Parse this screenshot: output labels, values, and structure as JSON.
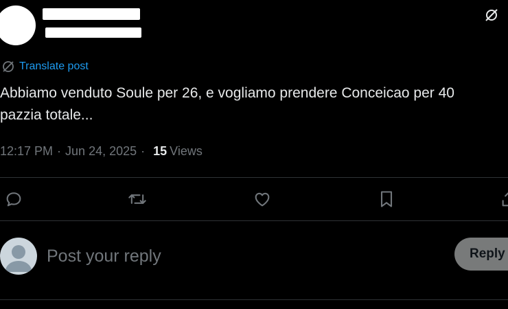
{
  "post": {
    "translate_label": "Translate post",
    "text": "Abbiamo venduto Soule per 26, e vogliamo prendere Conceicao per 40\npazzia totale...",
    "time": "12:17 PM",
    "date": "Jun 24, 2025",
    "views_count": "15",
    "views_label": "Views"
  },
  "reply": {
    "placeholder": "Post your reply",
    "button_label": "Reply"
  },
  "colors": {
    "background": "#000000",
    "text": "#e7e9ea",
    "secondary": "#71767b",
    "link": "#1d9bf0",
    "divider": "#2f3336"
  },
  "icons": [
    "grok-icon",
    "globe-translate-icon",
    "reply-icon",
    "repost-icon",
    "like-icon",
    "bookmark-icon",
    "share-icon",
    "default-avatar-icon"
  ]
}
